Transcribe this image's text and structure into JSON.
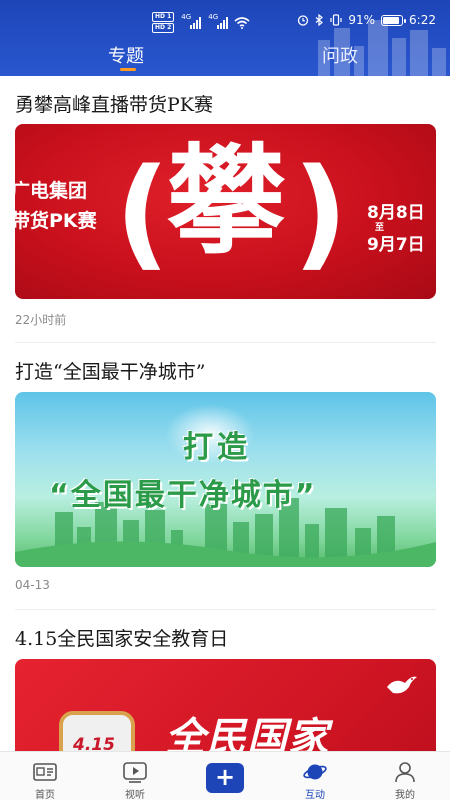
{
  "status_bar": {
    "hd1": "HD 1",
    "hd2": "HD 2",
    "net1": "4G",
    "net2": "4G",
    "battery_percent": "91%",
    "battery_level": 0.91,
    "time": "6:22"
  },
  "tabs": [
    {
      "label": "专题",
      "active": true
    },
    {
      "label": "问政",
      "active": false
    }
  ],
  "articles": [
    {
      "title": "勇攀高峰直播带货PK赛",
      "time": "22小时前",
      "image_text": {
        "left_line1": "广电集团",
        "left_line2": "带货PK赛",
        "center": "攀",
        "date_start": "8月8日",
        "date_sep": "至",
        "date_end": "9月7日"
      }
    },
    {
      "title": "打造“全国最干净城市”",
      "time": "04-13",
      "image_text": {
        "line1": "打造",
        "line2": "“全国最干净城市”"
      }
    },
    {
      "title": "4.15全民国家安全教育日",
      "time": "",
      "image_text": {
        "badge": "4.15",
        "headline": "全民国家"
      }
    }
  ],
  "bottom_nav": [
    {
      "label": "首页",
      "icon": "home-news-icon",
      "active": false
    },
    {
      "label": "视听",
      "icon": "video-play-icon",
      "active": false
    },
    {
      "label": "+",
      "icon": "plus-icon",
      "active": false
    },
    {
      "label": "互动",
      "icon": "planet-icon",
      "active": true
    },
    {
      "label": "我的",
      "icon": "user-icon",
      "active": false
    }
  ],
  "colors": {
    "header_blue": "#1d45b8",
    "tab_indicator": "#ff9b1f",
    "active_nav": "#1d45b8"
  }
}
